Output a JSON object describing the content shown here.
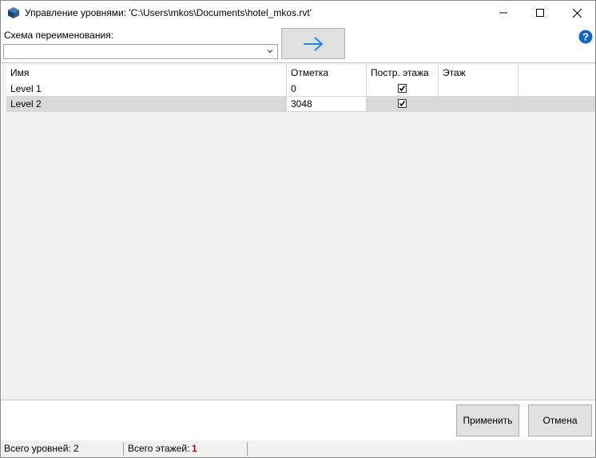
{
  "window": {
    "title": "Управление уровнями: 'C:\\Users\\mkos\\Documents\\hotel_mkos.rvt'"
  },
  "scheme": {
    "label": "Схема переименования:",
    "value": ""
  },
  "grid": {
    "columns": [
      "Имя",
      "Отметка",
      "Постр. этажа",
      "Этаж"
    ],
    "rows": [
      {
        "name": "Level 1",
        "elevation": "0",
        "building_story": true,
        "floor": ""
      },
      {
        "name": "Level 2",
        "elevation": "3048",
        "building_story": true,
        "floor": ""
      }
    ]
  },
  "buttons": {
    "apply": "Применить",
    "cancel": "Отмена"
  },
  "status": {
    "levels_label": "Всего уровней:",
    "levels_value": "2",
    "floors_label": "Всего этажей:",
    "floors_value": "1"
  },
  "colors": {
    "accent_arrow": "#1e88e5",
    "help_icon": "#1565c0",
    "selected_row": "#d9d9d9",
    "floors_value": "#b00000"
  }
}
